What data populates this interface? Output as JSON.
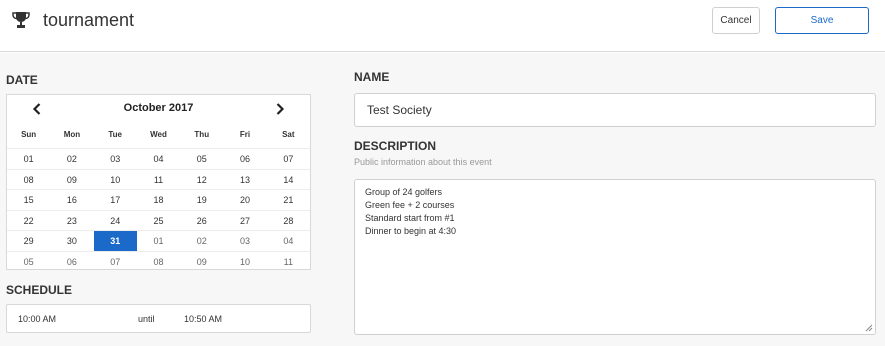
{
  "header": {
    "title": "tournament",
    "trophy_icon": "trophy-icon",
    "cancel_label": "Cancel",
    "save_label": "Save"
  },
  "date": {
    "label": "DATE",
    "month_label": "October 2017",
    "prev_icon": "chevron-left-icon",
    "next_icon": "chevron-right-icon",
    "weekdays": [
      "Sun",
      "Mon",
      "Tue",
      "Wed",
      "Thu",
      "Fri",
      "Sat"
    ],
    "weeks": [
      [
        "01",
        "02",
        "03",
        "04",
        "05",
        "06",
        "07"
      ],
      [
        "08",
        "09",
        "10",
        "11",
        "12",
        "13",
        "14"
      ],
      [
        "15",
        "16",
        "17",
        "18",
        "19",
        "20",
        "21"
      ],
      [
        "22",
        "23",
        "24",
        "25",
        "26",
        "27",
        "28"
      ],
      [
        "29",
        "30",
        "31",
        "01",
        "02",
        "03",
        "04"
      ],
      [
        "05",
        "06",
        "07",
        "08",
        "09",
        "10",
        "11"
      ]
    ],
    "selected_day": "31",
    "selected_color": "#1b6ac9"
  },
  "schedule": {
    "label": "SCHEDULE",
    "start": "10:00 AM",
    "separator": "until",
    "end": "10:50 AM"
  },
  "name": {
    "label": "NAME",
    "value": "Test Society"
  },
  "description": {
    "label": "DESCRIPTION",
    "help": "Public information about this event",
    "lines": [
      "Group of 24 golfers",
      "Green fee + 2 courses",
      "Standard start from #1",
      "Dinner to begin at 4:30"
    ]
  }
}
